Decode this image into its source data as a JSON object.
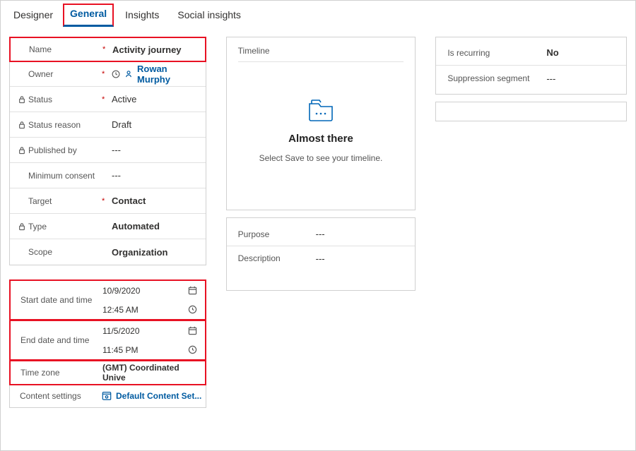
{
  "tabs": {
    "designer": "Designer",
    "general": "General",
    "insights": "Insights",
    "social": "Social insights"
  },
  "fields": {
    "name": {
      "label": "Name",
      "value": "Activity journey"
    },
    "owner": {
      "label": "Owner",
      "value": "Rowan Murphy"
    },
    "status": {
      "label": "Status",
      "value": "Active"
    },
    "status_reason": {
      "label": "Status reason",
      "value": "Draft"
    },
    "published_by": {
      "label": "Published by",
      "value": "---"
    },
    "min_consent": {
      "label": "Minimum consent",
      "value": "---"
    },
    "target": {
      "label": "Target",
      "value": "Contact"
    },
    "type": {
      "label": "Type",
      "value": "Automated"
    },
    "scope": {
      "label": "Scope",
      "value": "Organization"
    }
  },
  "dates": {
    "start": {
      "label": "Start date and time",
      "date": "10/9/2020",
      "time": "12:45 AM"
    },
    "end": {
      "label": "End date and time",
      "date": "11/5/2020",
      "time": "11:45 PM"
    },
    "tz": {
      "label": "Time zone",
      "value": "(GMT) Coordinated Unive"
    },
    "content": {
      "label": "Content settings",
      "value": "Default Content Set..."
    }
  },
  "timeline": {
    "title": "Timeline",
    "heading": "Almost there",
    "subtext": "Select Save to see your timeline."
  },
  "meta": {
    "purpose": {
      "label": "Purpose",
      "value": "---"
    },
    "description": {
      "label": "Description",
      "value": "---"
    }
  },
  "right": {
    "recurring": {
      "label": "Is recurring",
      "value": "No"
    },
    "suppression": {
      "label": "Suppression segment",
      "value": "---"
    }
  }
}
